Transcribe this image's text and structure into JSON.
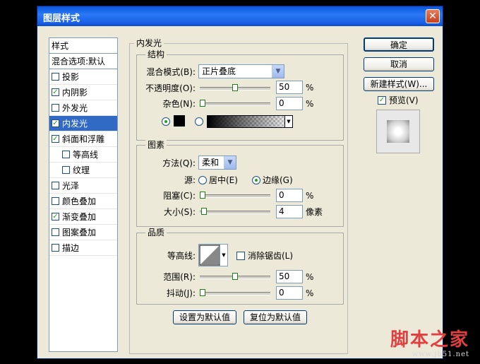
{
  "window": {
    "title": "图层样式",
    "close_glyph": "✕"
  },
  "style_list": {
    "header": "样式",
    "blend_options": "混合选项:默认",
    "items": [
      {
        "label": "投影",
        "checked": false,
        "indent": false,
        "selected": false
      },
      {
        "label": "内阴影",
        "checked": true,
        "indent": false,
        "selected": false
      },
      {
        "label": "外发光",
        "checked": false,
        "indent": false,
        "selected": false
      },
      {
        "label": "内发光",
        "checked": true,
        "indent": false,
        "selected": true
      },
      {
        "label": "斜面和浮雕",
        "checked": true,
        "indent": false,
        "selected": false
      },
      {
        "label": "等高线",
        "checked": false,
        "indent": true,
        "selected": false
      },
      {
        "label": "纹理",
        "checked": false,
        "indent": true,
        "selected": false
      },
      {
        "label": "光泽",
        "checked": false,
        "indent": false,
        "selected": false
      },
      {
        "label": "颜色叠加",
        "checked": false,
        "indent": false,
        "selected": false
      },
      {
        "label": "渐变叠加",
        "checked": true,
        "indent": false,
        "selected": false
      },
      {
        "label": "图案叠加",
        "checked": false,
        "indent": false,
        "selected": false
      },
      {
        "label": "描边",
        "checked": false,
        "indent": false,
        "selected": false
      }
    ]
  },
  "panel": {
    "title": "内发光",
    "structure": {
      "legend": "结构",
      "blend_mode_label": "混合模式(B):",
      "blend_mode_value": "正片叠底",
      "opacity_label": "不透明度(O):",
      "opacity_value": "50",
      "opacity_unit": "%",
      "opacity_level": 0.5,
      "noise_label": "杂色(N):",
      "noise_value": "0",
      "noise_unit": "%",
      "noise_level": 0,
      "color_mode": "solid",
      "solid_color": "#000000"
    },
    "elements": {
      "legend": "图素",
      "method_label": "方法(Q):",
      "method_value": "柔和",
      "source_label": "源:",
      "source_center": "居中(E)",
      "source_edge": "边缘(G)",
      "source_selected": "edge",
      "choke_label": "阻塞(C):",
      "choke_value": "0",
      "choke_unit": "%",
      "choke_level": 0,
      "size_label": "大小(S):",
      "size_value": "4",
      "size_unit": "像素"
    },
    "quality": {
      "legend": "品质",
      "contour_label": "等高线:",
      "antialias_label": "消除锯齿(L)",
      "antialias_checked": false,
      "range_label": "范围(R):",
      "range_value": "50",
      "range_unit": "%",
      "range_level": 0.5,
      "jitter_label": "抖动(J):",
      "jitter_value": "0",
      "jitter_unit": "%",
      "jitter_level": 0
    },
    "make_default": "设置为默认值",
    "reset_default": "复位为默认值"
  },
  "buttons": {
    "ok": "确定",
    "cancel": "取消",
    "new_style": "新建样式(W)...",
    "preview_label": "预览(V)",
    "preview_checked": true
  },
  "watermark": {
    "main": "脚本之家",
    "url": "www.jb51.net"
  }
}
